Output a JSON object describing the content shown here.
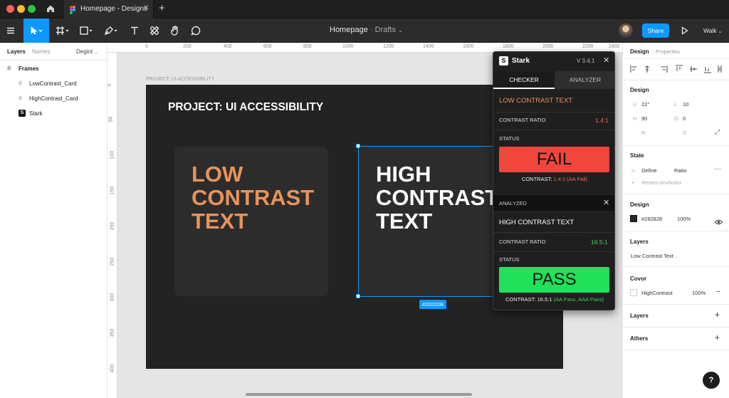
{
  "tab": {
    "title": "Homepage - Designs"
  },
  "toolbar": {
    "file_name": "Homepage",
    "location": "Drafts",
    "share_label": "Share",
    "walk_label": "Walk"
  },
  "layers_panel": {
    "tab_layers": "Layers",
    "tab_names": "Names",
    "tab_page": "Degint",
    "section_title": "Frames",
    "items": [
      {
        "label": "LowContrast_Card"
      },
      {
        "label": "HighContrast_Card"
      },
      {
        "label": "Stark"
      }
    ]
  },
  "canvas": {
    "ruler_top": [
      "0",
      "200",
      "400",
      "600",
      "800",
      "1000",
      "1200",
      "1400",
      "1600",
      "1800",
      "2000",
      "2200",
      "2400"
    ],
    "ruler_left": [
      "0",
      "50",
      "100",
      "150",
      "200",
      "250",
      "300",
      "350",
      "400",
      "450"
    ],
    "frame_label": "PROJECT: UI ACCESSIBILITY",
    "frame_title": "PROJECT: UI ACCESSIBILITY",
    "low_card": {
      "line1": "LOW",
      "line2": "CONTRAST",
      "line3": "TEXT",
      "text_color": "#E8935A"
    },
    "high_card": {
      "line1": "HIGH",
      "line2": "CONTRAST",
      "line3": "TEXT",
      "text_color": "#FFFFFF"
    },
    "selection_badge": "#20202B"
  },
  "stark": {
    "title": "Stark",
    "version": "V 3.4.1",
    "tab_checker": "CHECKER",
    "tab_analyzer": "ANALYZER",
    "low": {
      "heading": "LOW CONTRAST TEXT",
      "ratio_label": "CONTRAST RATIO",
      "ratio_value": "1.4:1",
      "status_label": "STATUS",
      "result": "FAIL",
      "summary_prefix": "CONTRAST:",
      "summary_value": "1.4:1 (AA Fail)"
    },
    "analyzed_label": "ANALYZED",
    "high": {
      "heading": "HIGH CONTRAST TEXT",
      "ratio_label": "CONTRAST RATIO",
      "ratio_value": "16.5:1",
      "status_label": "STATUS",
      "result": "PASS",
      "summary_prefix": "CONTRAST: 16.5:1",
      "summary_value": "(AA Pass, AAA Pass)"
    },
    "colors": {
      "fail": "#F0463C",
      "pass": "#21E05A",
      "fail_text": "#F06A55",
      "pass_text": "#3ED45F"
    }
  },
  "design_panel": {
    "tab_design": "Design",
    "tab_properties": "Properties",
    "section_design": "Design",
    "fields": {
      "u_label": "U",
      "u_value": "22°",
      "l_label": "L",
      "l_value": "10",
      "h_label": "H",
      "h_value": "90",
      "o_label": "O",
      "o_value": "0",
      "r_label": "R",
      "s_label": "S"
    },
    "section_state": "State",
    "state_define": "Define",
    "state_ratio": "Ratio",
    "state_sub": "Resets-envlinder",
    "section_design2": "Design",
    "fill_hex": "#282828",
    "fill_opacity": "100%",
    "section_layers": "Layers",
    "layer_value": "Low Contrast Text",
    "section_cover": "Covor",
    "cover_name": "HighContrast",
    "cover_opacity": "100%",
    "section_layers2": "Layers",
    "section_others": "Athers",
    "help": "?"
  }
}
